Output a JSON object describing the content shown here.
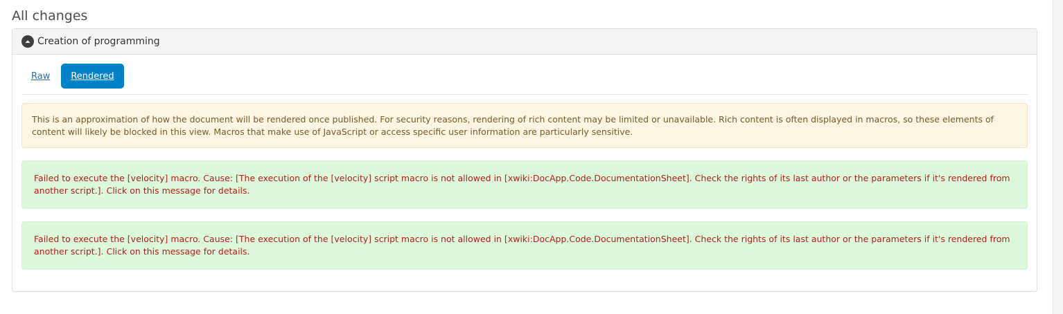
{
  "section": {
    "title": "All changes"
  },
  "panel": {
    "title": "Creation of programming",
    "toggle_icon": "chevron-up-icon"
  },
  "tabs": [
    {
      "label": "Raw",
      "active": false
    },
    {
      "label": "Rendered",
      "active": true
    }
  ],
  "warning": {
    "text": "This is an approximation of how the document will be rendered once published. For security reasons, rendering of rich content may be limited or unavailable. Rich content is often displayed in macros, so these elements of content will likely be blocked in this view. Macros that make use of JavaScript or access specific user information are particularly sensitive."
  },
  "errors": [
    {
      "text": "Failed to execute the [velocity] macro. Cause: [The execution of the [velocity] script macro is not allowed in [xwiki:DocApp.Code.DocumentationSheet]. Check the rights of its last author or the parameters if it's rendered from another script.]. Click on this message for details."
    },
    {
      "text": "Failed to execute the [velocity] macro. Cause: [The execution of the [velocity] script macro is not allowed in [xwiki:DocApp.Code.DocumentationSheet]. Check the rights of its last author or the parameters if it's rendered from another script.]. Click on this message for details."
    }
  ],
  "colors": {
    "active_tab": "#0081c8",
    "warning_bg": "#fdf6e3",
    "error_bg": "#dcfadb",
    "error_text": "#b71c1c"
  }
}
